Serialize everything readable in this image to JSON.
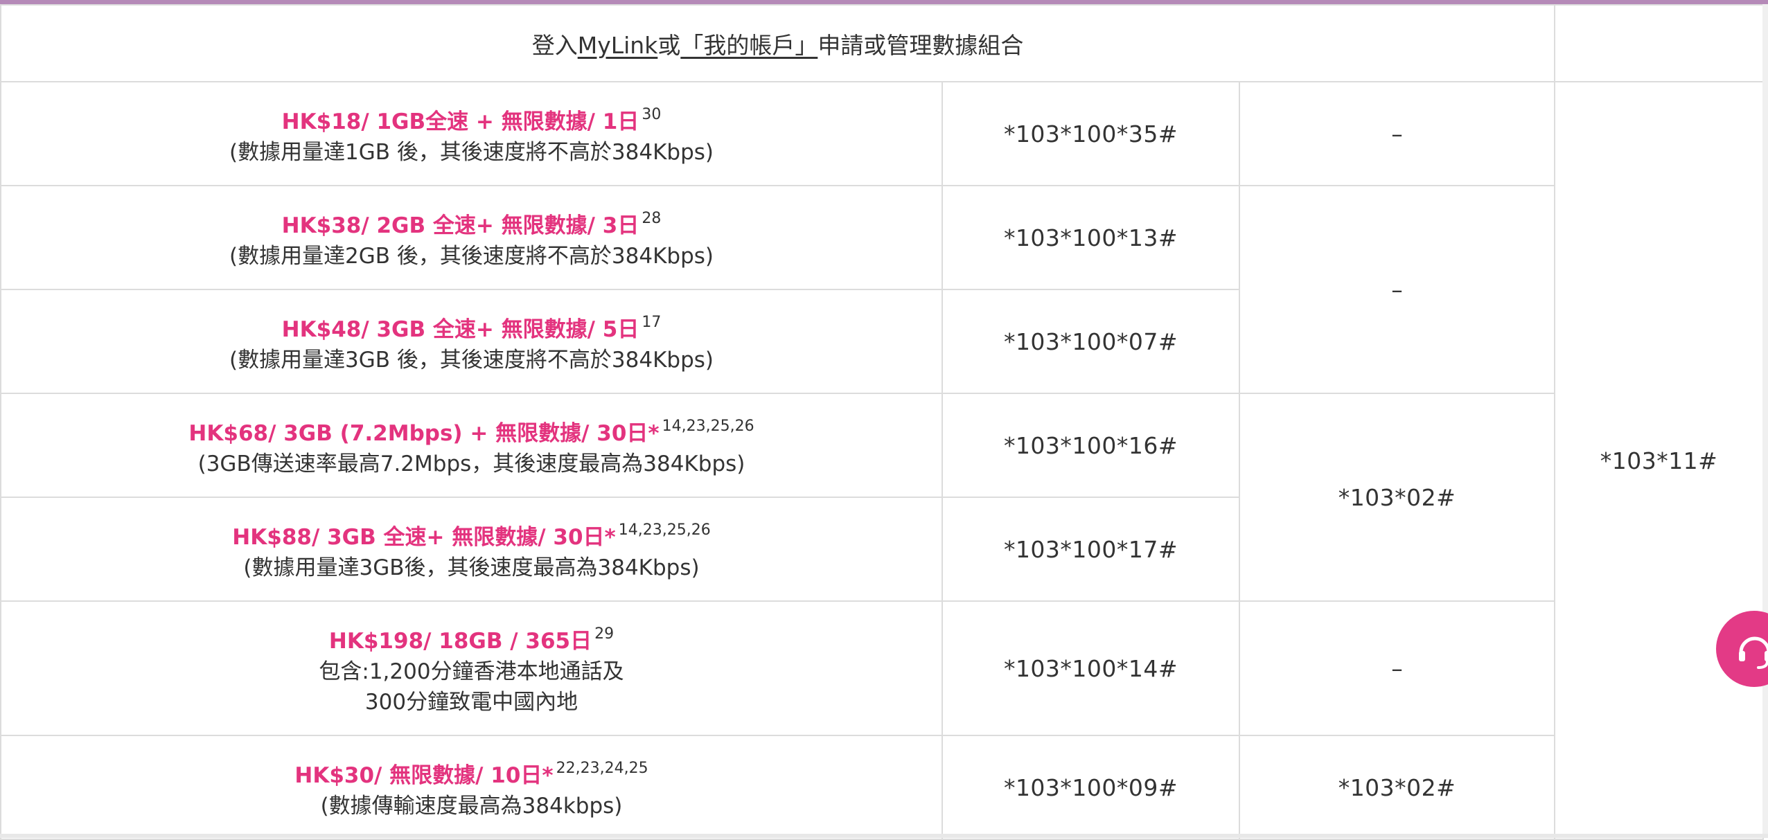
{
  "header": {
    "prefix": "登入",
    "mylink": "MyLink",
    "or": "或",
    "account": "「我的帳戶」",
    "suffix": "申請或管理數據組合"
  },
  "plans": [
    {
      "title": "HK$18/ 1GB全速 + 無限數據/ 1日",
      "notes": "30",
      "desc": [
        "(數據用量達1GB 後，其後速度將不高於384Kbps)"
      ],
      "code": "*103*100*35#"
    },
    {
      "title": "HK$38/ 2GB 全速+ 無限數據/ 3日",
      "notes": "28",
      "desc": [
        "(數據用量達2GB 後，其後速度將不高於384Kbps)"
      ],
      "code": "*103*100*13#"
    },
    {
      "title": "HK$48/ 3GB 全速+ 無限數據/ 5日",
      "notes": "17",
      "desc": [
        "(數據用量達3GB 後，其後速度將不高於384Kbps)"
      ],
      "code": "*103*100*07#"
    },
    {
      "title": "HK$68/ 3GB (7.2Mbps) + 無限數據/ 30日*",
      "notes": "14,23,25,26",
      "desc": [
        "(3GB傳送速率最高7.2Mbps，其後速度最高為384Kbps)"
      ],
      "code": "*103*100*16#"
    },
    {
      "title": "HK$88/ 3GB 全速+ 無限數據/ 30日*",
      "notes": "14,23,25,26",
      "desc": [
        "(數據用量達3GB後，其後速度最高為384Kbps)"
      ],
      "code": "*103*100*17#"
    },
    {
      "title": "HK$198/ 18GB / 365日",
      "notes": "29",
      "desc": [
        "包含:1,200分鐘香港本地通話及",
        "300分鐘致電中國內地"
      ],
      "code": "*103*100*14#"
    },
    {
      "title": "HK$30/ 無限數據/ 10日*",
      "notes": "22,23,24,25",
      "desc": [
        "(數據傳輸速度最高為384kbps)"
      ],
      "code": "*103*100*09#"
    }
  ],
  "col3": {
    "row1": "–",
    "rows2_3": "–",
    "rows4_5": "*103*02#",
    "row6": "–",
    "row7": "*103*02#"
  },
  "col4": {
    "merged": "*103*11#"
  },
  "support": {
    "icon": "headset-icon",
    "color": "#e33a86"
  }
}
